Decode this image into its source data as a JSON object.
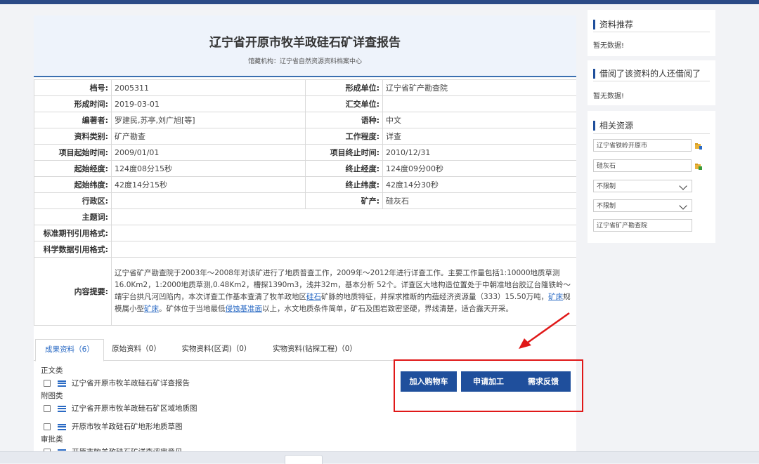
{
  "report": {
    "title": "辽宁省开原市牧羊政硅石矿详查报告",
    "subtitle": "馆藏机构：辽宁省自然资源资料档案中心"
  },
  "info_rows": [
    {
      "l1": "档号:",
      "v1": "2005311",
      "l2": "形成单位:",
      "v2": "辽宁省矿产勘查院"
    },
    {
      "l1": "形成时间:",
      "v1": "2019-03-01",
      "l2": "汇交单位:",
      "v2": ""
    },
    {
      "l1": "编著者:",
      "v1": "罗建民,苏亭,刘广旭[等]",
      "l2": "语种:",
      "v2": "中文"
    },
    {
      "l1": "资料类别:",
      "v1": "矿产勘查",
      "l2": "工作程度:",
      "v2": "详查"
    },
    {
      "l1": "项目起始时间:",
      "v1": "2009/01/01",
      "l2": "项目终止时间:",
      "v2": "2010/12/31"
    },
    {
      "l1": "起始经度:",
      "v1": "124度08分15秒",
      "l2": "终止经度:",
      "v2": "124度09分00秒"
    },
    {
      "l1": "起始纬度:",
      "v1": "42度14分15秒",
      "l2": "终止纬度:",
      "v2": "42度14分30秒"
    },
    {
      "l1": "行政区:",
      "v1": "",
      "l2": "矿产:",
      "v2": "硅灰石"
    }
  ],
  "single_rows": [
    {
      "label": "主题词:",
      "value": ""
    },
    {
      "label": "标准期刊引用格式:",
      "value": ""
    },
    {
      "label": "科学数据引用格式:",
      "value": ""
    }
  ],
  "abstract": {
    "label": "内容提要:",
    "part1": "辽宁省矿产勘查院于2003年～2008年对该矿进行了地质普查工作，2009年～2012年进行详查工作。主要工作量包括1:10000地质草测 16.0Km2，1:2000地质草测,0.48Km2，槽探1390m3，浅井32m，基本分析 52个。详查区大地构造位置处于中朝准地台胶辽台隆铁岭～靖宇台拱凡河凹陷内，本次详查工作基本查清了牧羊政地区",
    "link1": "硅石",
    "part2": "矿脉的地质特征，并探求推断的内蕴经济资源量（333）15.50万吨，",
    "link2": "矿床",
    "part3": "规模属小型",
    "link3": "矿床",
    "part4": "。矿体位于当地最低",
    "link4": "侵蚀基准面",
    "part5": "以上，水文地质条件简单，矿石及围岩致密坚硬，界线清楚，适合露天开采。"
  },
  "tabs": [
    {
      "label": "成果资料（6）"
    },
    {
      "label": "原始资料（0）"
    },
    {
      "label": "实物资料(区调)（0）"
    },
    {
      "label": "实物资料(钻探工程)（0）"
    }
  ],
  "files": {
    "cat1": "正文类",
    "file1": "辽宁省开原市牧羊政硅石矿详查报告",
    "cat2": "附图类",
    "file2": "辽宁省开原市牧羊政硅石矿区域地质图",
    "file3": "开原市牧羊政硅石矿地形地质草图",
    "cat3": "审批类",
    "file4": "开原市牧羊政硅石矿详查评审意见"
  },
  "buttons": {
    "cart": "加入购物车",
    "process": "申请加工",
    "feedback": "需求反馈"
  },
  "sidebar": {
    "recommend_title": "资料推荐",
    "recommend_empty": "暂无数据!",
    "borrowed_title": "借阅了该资料的人还借阅了",
    "borrowed_empty": "暂无数据!",
    "related_title": "相关资源",
    "related_input1": "辽宁省铁岭开原市",
    "related_input2": "硅灰石",
    "select1": "不限制",
    "select2": "不限制",
    "related_input3": "辽宁省矿产勘查院"
  },
  "colors": {
    "primary": "#1f4f9c",
    "accent_red": "#e01818",
    "link": "#2a6ac4"
  }
}
